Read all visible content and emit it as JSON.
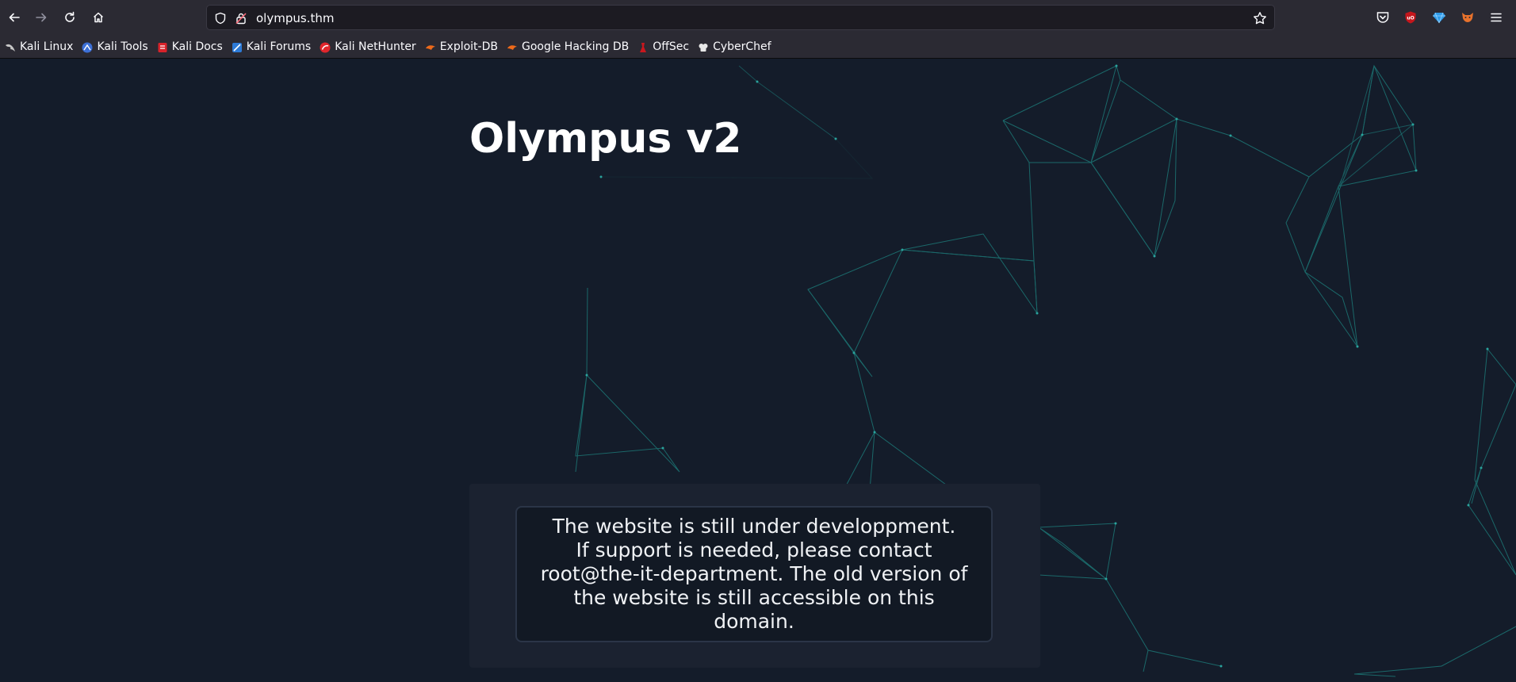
{
  "browser": {
    "url": "olympus.thm",
    "bookmarks": [
      {
        "label": "Kali Linux",
        "icon": "kali-dragon-icon",
        "color": "#3b3b3b"
      },
      {
        "label": "Kali Tools",
        "icon": "kali-tools-icon",
        "color": "#3c6fd6"
      },
      {
        "label": "Kali Docs",
        "icon": "kali-docs-icon",
        "color": "#d8222a"
      },
      {
        "label": "Kali Forums",
        "icon": "kali-forums-icon",
        "color": "#2d7ad6"
      },
      {
        "label": "Kali NetHunter",
        "icon": "kali-nethunter-icon",
        "color": "#e0262c"
      },
      {
        "label": "Exploit-DB",
        "icon": "exploit-db-icon",
        "color": "#ee6a1a"
      },
      {
        "label": "Google Hacking DB",
        "icon": "ghdb-icon",
        "color": "#ee6a1a"
      },
      {
        "label": "OffSec",
        "icon": "offsec-icon",
        "color": "#c8171e"
      },
      {
        "label": "CyberChef",
        "icon": "cyberchef-icon",
        "color": "#e8e8e8"
      }
    ]
  },
  "page": {
    "title": "Olympus v2",
    "message_lines": [
      "The website is still under developpment.",
      "If support is needed, please contact",
      "root@the-it-department. The old version of",
      "the website is still accessible on this domain."
    ]
  },
  "colors": {
    "background": "#141c2a",
    "network_lines": "#1f8a86",
    "panel": "#1b2230"
  }
}
